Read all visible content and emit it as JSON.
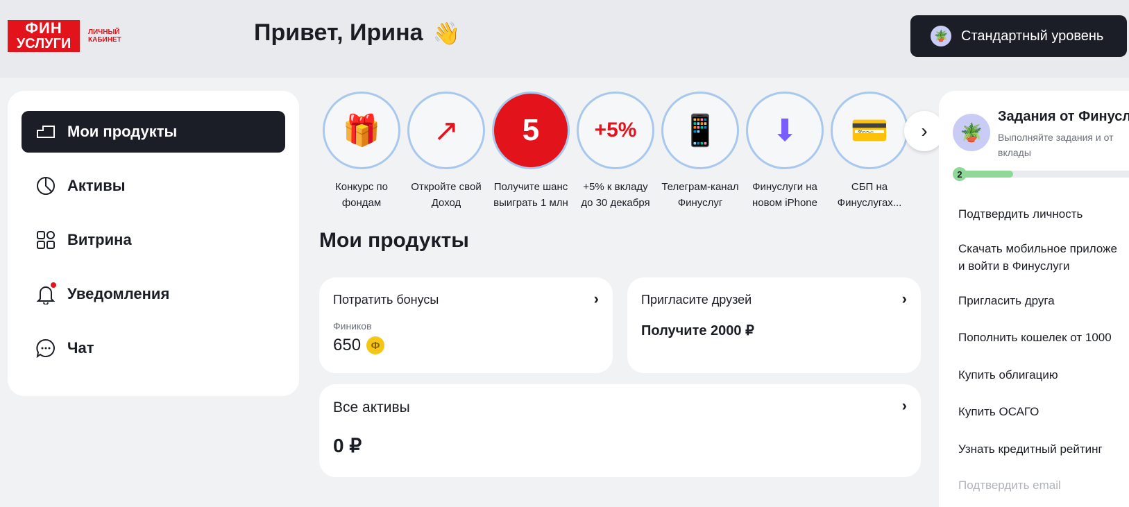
{
  "header": {
    "logo_line1": "ФИН",
    "logo_line2": "УСЛУГИ",
    "logo_sub1": "ЛИЧНЫЙ",
    "logo_sub2": "КАБИНЕТ",
    "greeting": "Привет, Ирина",
    "wave_emoji": "👋",
    "level_label": "Стандартный уровень"
  },
  "sidebar": {
    "items": [
      {
        "label": "Мои продукты",
        "icon": "wallet-icon",
        "active": true
      },
      {
        "label": "Активы",
        "icon": "pie-chart-icon"
      },
      {
        "label": "Витрина",
        "icon": "grid-icon"
      },
      {
        "label": "Уведомления",
        "icon": "bell-icon",
        "badge": true
      },
      {
        "label": "Чат",
        "icon": "chat-icon"
      }
    ]
  },
  "stories": [
    {
      "line1": "Конкурс по",
      "line2": "фондам",
      "icon": "🎁"
    },
    {
      "line1": "Откройте свой",
      "line2": "Доход",
      "icon": "↗"
    },
    {
      "line1": "Получите шанс",
      "line2": "выиграть 1 млн",
      "icon": "5"
    },
    {
      "line1": "+5% к вкладу",
      "line2": "до 30 декабря",
      "icon": "+5%"
    },
    {
      "line1": "Телеграм-канал",
      "line2": "Финуслуг",
      "icon": "📱"
    },
    {
      "line1": "Финуслуги на",
      "line2": "новом iPhone",
      "icon": "⬇"
    },
    {
      "line1": "СБП на",
      "line2": "Финуслугах...",
      "icon": "💳"
    }
  ],
  "main": {
    "title": "Мои продукты",
    "bonus_card": {
      "title": "Потратить бонусы",
      "sub": "Фиников",
      "value": "650",
      "coin": "Ф"
    },
    "invite_card": {
      "title": "Пригласите друзей",
      "value": "Получите 2000 ₽"
    },
    "assets_card": {
      "title": "Все активы",
      "value": "0 ₽"
    }
  },
  "tasks": {
    "title": "Задания от Финусл",
    "desc1": "Выполняйте задания и от",
    "desc2": "вклады",
    "progress_value": "2",
    "progress_fraction": 0.3,
    "items": [
      {
        "line1": "Подтвердить личность"
      },
      {
        "line1": "Скачать мобильное приложе",
        "line2": "и войти в Финуслуги"
      },
      {
        "line1": "Пригласить друга"
      },
      {
        "line1": "Пополнить кошелек от 1000"
      },
      {
        "line1": "Купить облигацию"
      },
      {
        "line1": "Купить ОСАГО"
      },
      {
        "line1": "Узнать кредитный рейтинг"
      },
      {
        "line1": "Подтвердить email",
        "muted": true
      }
    ]
  },
  "colors": {
    "brand": "#e3131c",
    "dark": "#1c1e27",
    "progress": "#8fd89a"
  }
}
